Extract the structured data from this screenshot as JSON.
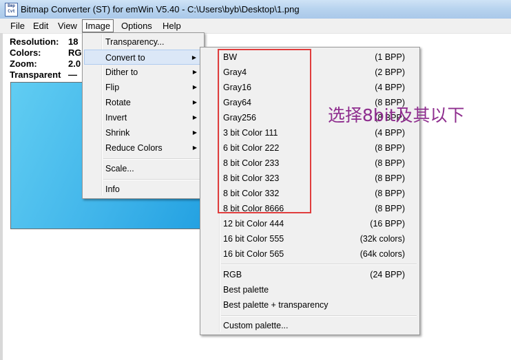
{
  "window": {
    "title": "Bitmap Converter (ST) for emWin V5.40 - C:\\Users\\byb\\Desktop\\1.png",
    "icon": "BmpCvt"
  },
  "menubar": [
    "File",
    "Edit",
    "View",
    "Image",
    "Options",
    "Help"
  ],
  "info": [
    {
      "label": "Resolution:",
      "value": "18"
    },
    {
      "label": "Colors:",
      "value": "RG"
    },
    {
      "label": "Zoom:",
      "value": "2.0"
    },
    {
      "label": "Transparent",
      "value": "—"
    }
  ],
  "image_menu": [
    {
      "label": "Transparency...",
      "submenu": false
    },
    {
      "label": "Convert to",
      "submenu": true,
      "highlighted": true
    },
    {
      "label": "Dither to",
      "submenu": true
    },
    {
      "label": "Flip",
      "submenu": true
    },
    {
      "label": "Rotate",
      "submenu": true
    },
    {
      "label": "Invert",
      "submenu": true
    },
    {
      "label": "Shrink",
      "submenu": true
    },
    {
      "label": "Reduce Colors",
      "submenu": true
    },
    {
      "label": "Scale...",
      "submenu": false
    },
    {
      "label": "Info",
      "submenu": false
    }
  ],
  "convert_menu": [
    {
      "label": "BW",
      "bpp": "(1 BPP)"
    },
    {
      "label": "Gray4",
      "bpp": "(2 BPP)"
    },
    {
      "label": "Gray16",
      "bpp": "(4 BPP)"
    },
    {
      "label": "Gray64",
      "bpp": "(8 BPP)"
    },
    {
      "label": "Gray256",
      "bpp": "(8 BPP)"
    },
    {
      "label": "3 bit Color 111",
      "bpp": "(4 BPP)"
    },
    {
      "label": "6 bit Color 222",
      "bpp": "(8 BPP)"
    },
    {
      "label": "8 bit Color 233",
      "bpp": "(8 BPP)"
    },
    {
      "label": "8 bit Color 323",
      "bpp": "(8 BPP)"
    },
    {
      "label": "8 bit Color 332",
      "bpp": "(8 BPP)"
    },
    {
      "label": "8 bit Color 8666",
      "bpp": "(8 BPP)"
    },
    {
      "label": "12 bit Color 444",
      "bpp": "(16 BPP)"
    },
    {
      "label": "16 bit Color 555",
      "bpp": "(32k colors)"
    },
    {
      "label": "16 bit Color 565",
      "bpp": "(64k colors)"
    },
    {
      "label": "RGB",
      "bpp": "(24 BPP)"
    },
    {
      "label": "Best palette",
      "bpp": ""
    },
    {
      "label": "Best palette + transparency",
      "bpp": ""
    },
    {
      "label": "Custom palette...",
      "bpp": ""
    }
  ],
  "annotation": {
    "text": "选择8bit及其以下",
    "box_color": "#e03c3c",
    "text_color": "#8e2d8e"
  }
}
